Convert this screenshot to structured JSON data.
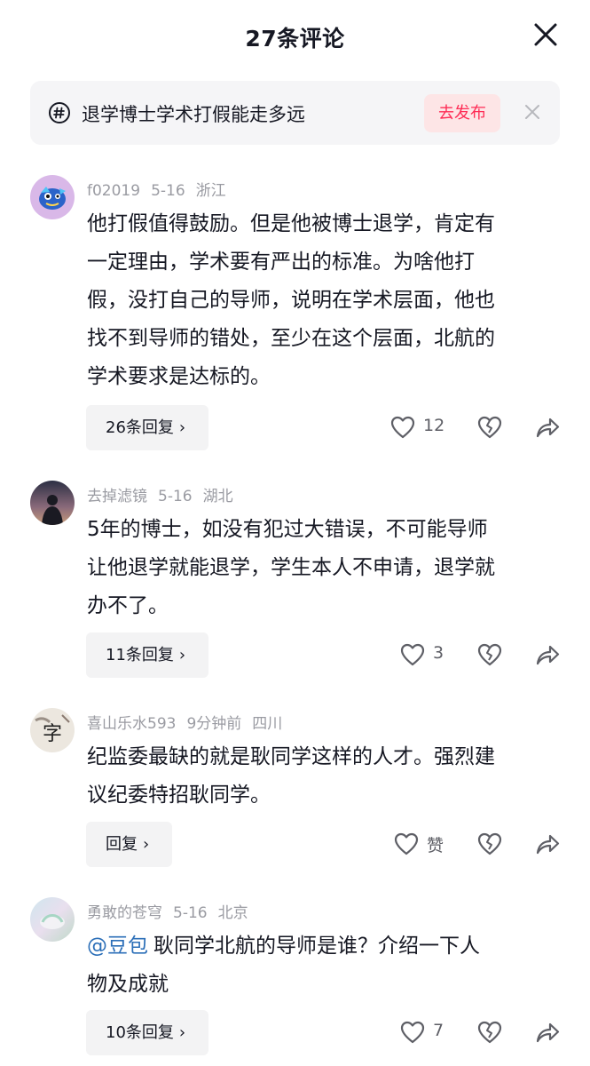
{
  "header": {
    "title": "27条评论",
    "close_icon": "close-icon"
  },
  "topic": {
    "icon": "hashtag-icon",
    "text": "退学博士学术打假能走多远",
    "publish_label": "去发布",
    "dismiss_icon": "close-icon",
    "accent": "#fe2c55"
  },
  "comments": [
    {
      "username": "f02019",
      "date": "5-16",
      "location": "浙江",
      "text_lines": [
        "他打假值得鼓励。但是他被博士退学，肯定有",
        "一定理由，学术要有严出的标准。为啥他打",
        "假，没打自己的导师，说明在学术层面，他也",
        "找不到导师的错处，至少在这个层面，北航的",
        "学术要求是达标的。"
      ],
      "reply_label": "26条回复",
      "likes": "12"
    },
    {
      "username": "去掉滤镜",
      "date": "5-16",
      "location": "湖北",
      "text_lines": [
        "5年的博士，如没有犯过大错误，不可能导师",
        "让他退学就能退学，学生本人不申请，退学就",
        "办不了。"
      ],
      "reply_label": "11条回复",
      "likes": "3"
    },
    {
      "username": "喜山乐水593",
      "date": "9分钟前",
      "location": "四川",
      "text_lines": [
        "纪监委最缺的就是耿同学这样的人才。强烈建",
        "议纪委特招耿同学。"
      ],
      "reply_label": "回复",
      "likes": "赞"
    },
    {
      "username": "勇敢的苍穹",
      "date": "5-16",
      "location": "北京",
      "mention": "@豆包",
      "text_lines": [
        "耿同学北航的导师是谁？介绍一下人",
        "物及成就"
      ],
      "reply_label": "10条回复",
      "likes": "7"
    }
  ],
  "icons": {
    "like": "heart-icon",
    "dislike": "broken-heart-icon",
    "share": "share-icon",
    "chevron": "chevron-right-icon"
  }
}
